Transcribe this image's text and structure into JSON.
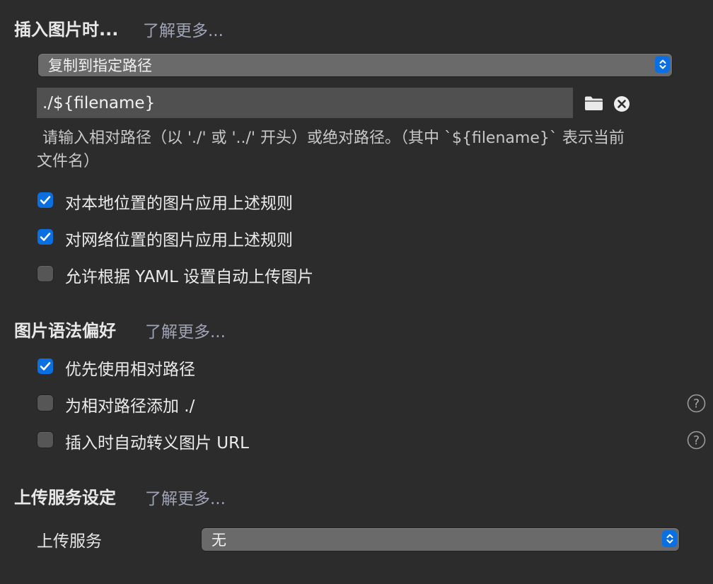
{
  "sections": {
    "insert": {
      "title": "插入图片时...",
      "learn_more": "了解更多..."
    },
    "syntax": {
      "title": "图片语法偏好",
      "learn_more": "了解更多..."
    },
    "upload": {
      "title": "上传服务设定",
      "learn_more": "了解更多..."
    }
  },
  "insert_action": {
    "selected": "复制到指定路径"
  },
  "path_field": {
    "value": "./${filename}"
  },
  "path_hint": {
    "line1": "请输入相对路径（以 './' 或 '../' 开头）或绝对路径。（其中 `${filename}` 表示当前",
    "line2": "文件名）"
  },
  "insert_options": [
    {
      "label": "对本地位置的图片应用上述规则",
      "checked": true
    },
    {
      "label": "对网络位置的图片应用上述规则",
      "checked": true
    },
    {
      "label": "允许根据 YAML 设置自动上传图片",
      "checked": false
    }
  ],
  "syntax_options": [
    {
      "label": "优先使用相对路径",
      "checked": true,
      "help": false
    },
    {
      "label": "为相对路径添加 ./",
      "checked": false,
      "help": true
    },
    {
      "label": "插入时自动转义图片 URL",
      "checked": false,
      "help": true
    }
  ],
  "upload_service": {
    "label": "上传服务",
    "selected": "无"
  },
  "colors": {
    "background": "#2c2c2c",
    "accent": "#0a6fe0",
    "link": "#9fa3b6"
  },
  "icons": {
    "folder": "folder-icon",
    "clear": "clear-icon",
    "help": "help-icon",
    "check": "checkmark-icon",
    "stepper": "up-down-chevron-icon"
  }
}
